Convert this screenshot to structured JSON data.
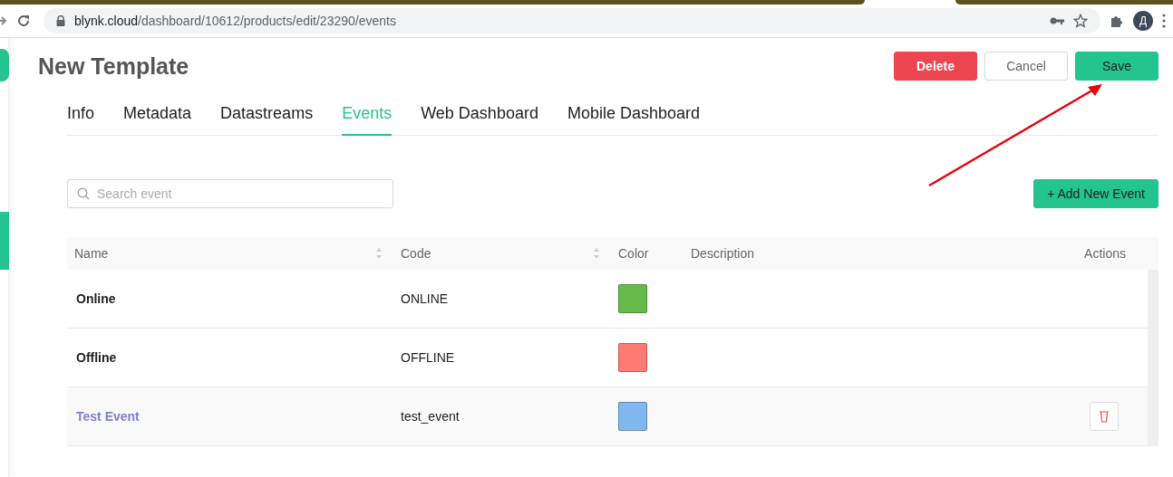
{
  "browser": {
    "url_host": "blynk.cloud",
    "url_path": "/dashboard/10612/products/edit/23290/events",
    "profile_initial": "Д"
  },
  "page": {
    "title": "New Template",
    "buttons": [
      {
        "label": "Delete",
        "kind": "danger"
      },
      {
        "label": "Cancel",
        "kind": "plain"
      },
      {
        "label": "Save",
        "kind": "primary"
      }
    ]
  },
  "tabs": [
    {
      "label": "Info",
      "selected": false
    },
    {
      "label": "Metadata",
      "selected": false
    },
    {
      "label": "Datastreams",
      "selected": false
    },
    {
      "label": "Events",
      "selected": true
    },
    {
      "label": "Web Dashboard",
      "selected": false
    },
    {
      "label": "Mobile Dashboard",
      "selected": false
    }
  ],
  "search": {
    "placeholder": "Search event"
  },
  "add_button": "+ Add New Event",
  "table": {
    "columns": [
      {
        "label": "Name",
        "sortable": true
      },
      {
        "label": "Code",
        "sortable": true
      },
      {
        "label": "Color",
        "sortable": false
      },
      {
        "label": "Description",
        "sortable": false
      },
      {
        "label": "Actions",
        "sortable": false
      }
    ],
    "rows": [
      {
        "name": "Online",
        "code": "ONLINE",
        "color": "#66bb4a",
        "hovered": false
      },
      {
        "name": "Offline",
        "code": "OFFLINE",
        "color": "#ff7b74",
        "hovered": false
      },
      {
        "name": "Test Event",
        "code": "test_event",
        "color": "#82b8ee",
        "hovered": true
      }
    ]
  }
}
